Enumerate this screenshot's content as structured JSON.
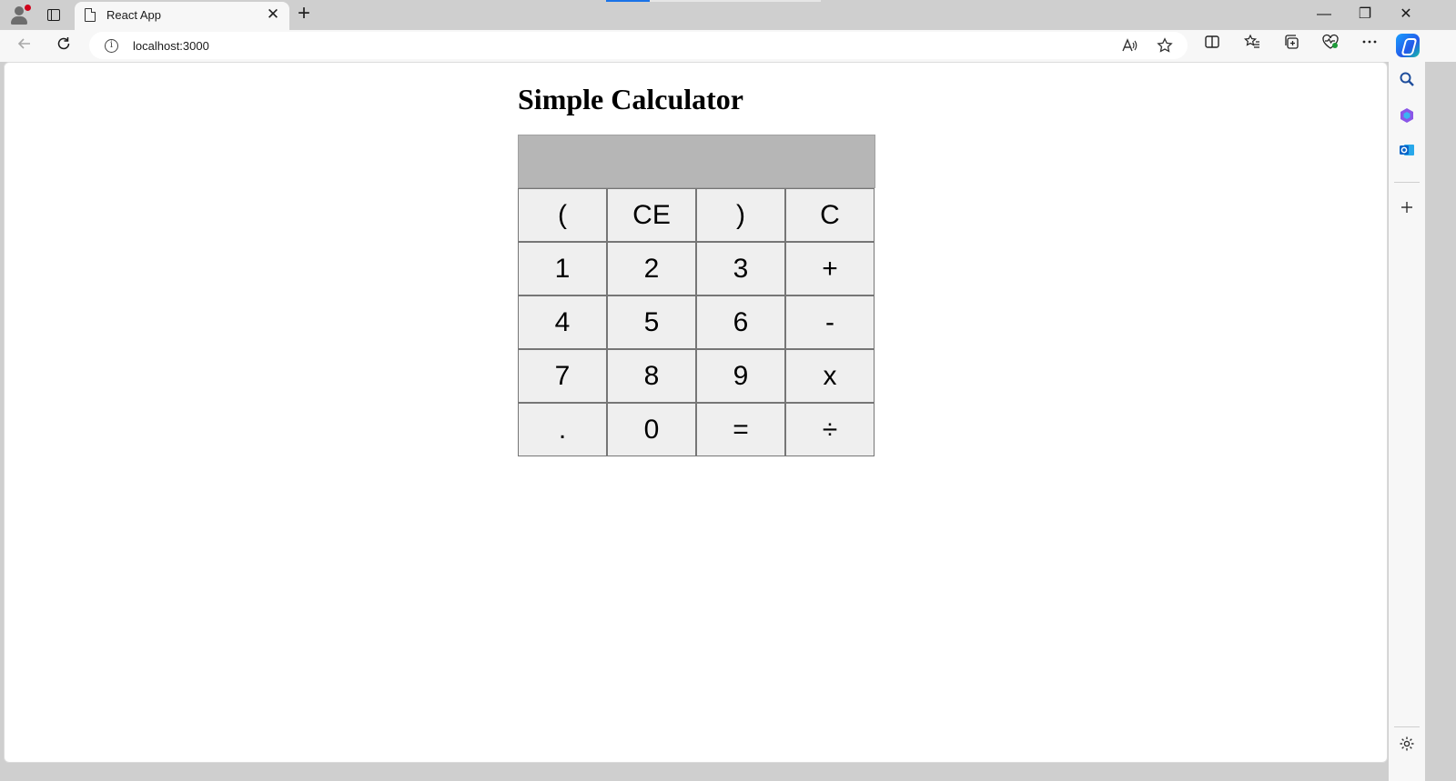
{
  "browser": {
    "tab_title": "React App",
    "tab_close": "✕",
    "new_tab": "+",
    "url": "localhost:3000",
    "window_controls": {
      "minimize": "—",
      "restore": "❐",
      "close": "✕"
    }
  },
  "app": {
    "title": "Simple Calculator",
    "display_value": "",
    "keys": [
      "(",
      "CE",
      ")",
      "C",
      "1",
      "2",
      "3",
      "+",
      "4",
      "5",
      "6",
      "-",
      "7",
      "8",
      "9",
      "x",
      ".",
      "0",
      "=",
      "÷"
    ]
  },
  "icons": {
    "back": "back-arrow-icon",
    "refresh": "refresh-icon",
    "info": "info-icon",
    "read_aloud": "read-aloud-icon",
    "favorite": "star-icon",
    "split_screen": "split-screen-icon",
    "favorites": "favorites-icon",
    "collections": "collections-icon",
    "browser_essentials": "heart-pulse-icon",
    "more": "more-icon",
    "copilot": "copilot-icon",
    "search": "search-icon",
    "office": "office-icon",
    "outlook": "outlook-icon",
    "add": "plus-icon",
    "settings": "settings-icon"
  },
  "colors": {
    "display_bg": "#b6b6b6",
    "key_bg": "#efefef",
    "key_border": "#767676",
    "accent": "#1a73e8",
    "profile_badge": "#d0021b"
  }
}
